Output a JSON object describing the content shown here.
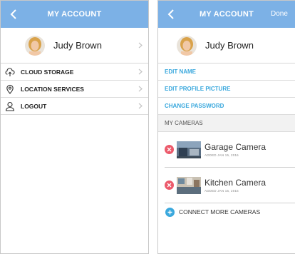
{
  "left": {
    "nav_title": "MY ACCOUNT",
    "profile_name": "Judy Brown",
    "menu": [
      {
        "label": "CLOUD STORAGE",
        "icon": "cloud-upload-icon"
      },
      {
        "label": "LOCATION SERVICES",
        "icon": "location-pin-icon"
      },
      {
        "label": "LOGOUT",
        "icon": "user-icon"
      }
    ]
  },
  "right": {
    "nav_title": "MY ACCOUNT",
    "done_label": "Done",
    "profile_name": "Judy Brown",
    "links": [
      "EDIT NAME",
      "EDIT PROFILE PICTURE",
      "CHANGE PASSWORD"
    ],
    "cameras_header": "MY CAMERAS",
    "cameras": [
      {
        "name": "Garage Camera",
        "added": "ADDED JAN 15, 2016"
      },
      {
        "name": "Kitchen Camera",
        "added": "ADDED JAN 15, 2016"
      }
    ],
    "connect_label": "CONNECT MORE CAMERAS"
  },
  "colors": {
    "nav": "#7cb1e6",
    "link": "#3aa8dd",
    "remove": "#ec5a6b"
  }
}
